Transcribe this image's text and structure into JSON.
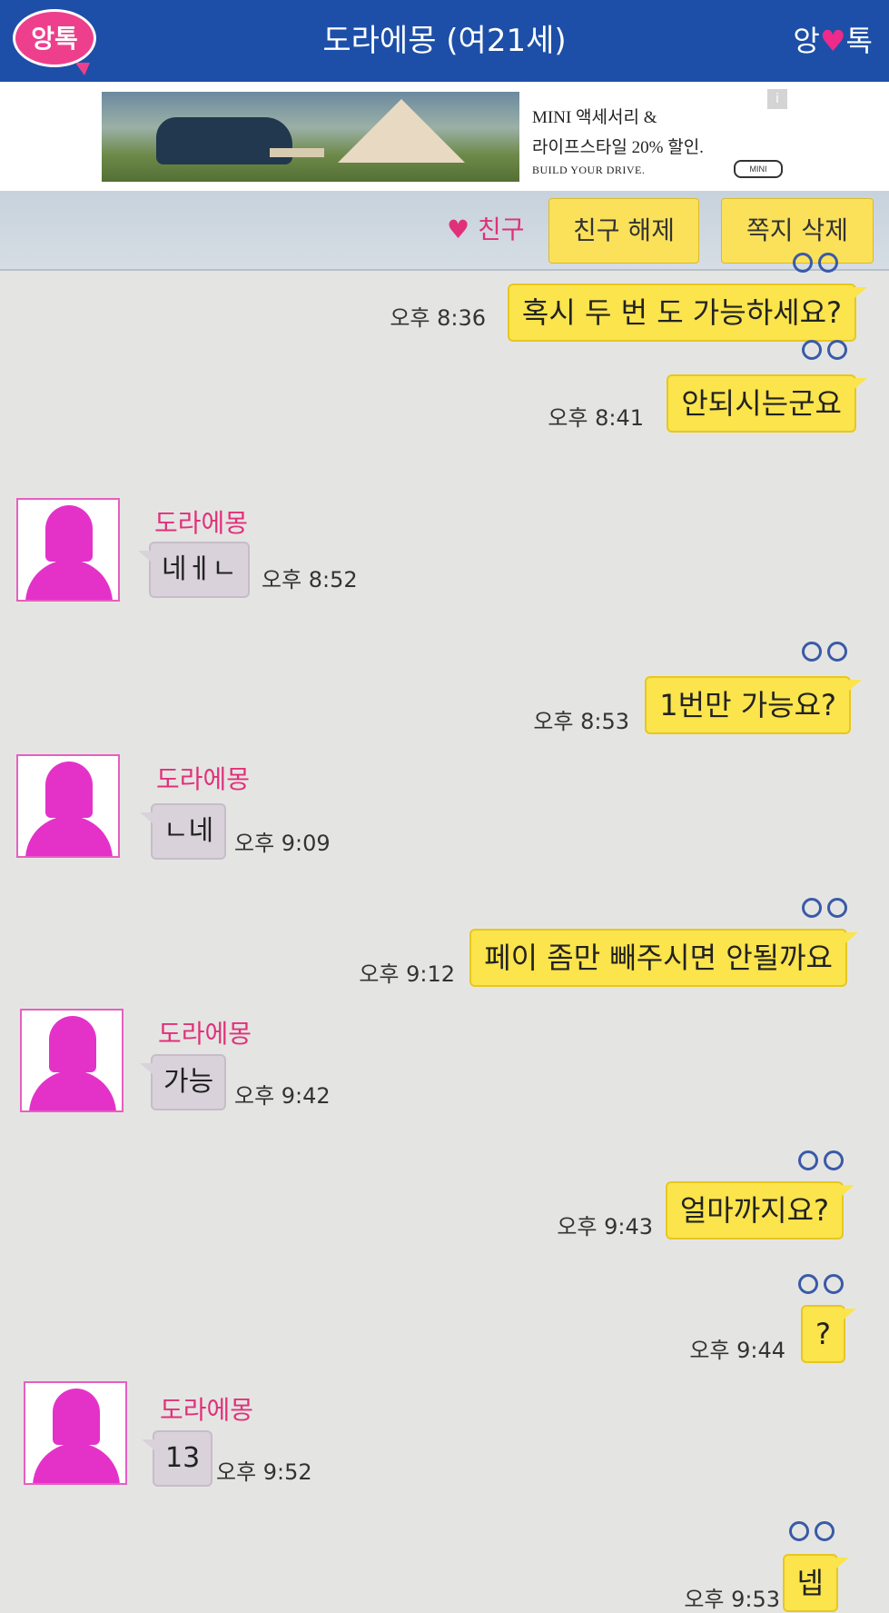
{
  "header": {
    "logo_text": "앙톡",
    "title": "도라에몽 (여21세)",
    "brand_left": "앙",
    "brand_heart": "♥",
    "brand_right": "톡"
  },
  "ad": {
    "line1": "MINI 액세서리 &",
    "line2": "라이프스타일 20% 할인.",
    "line3": "BUILD YOUR DRIVE.",
    "logo": "MINI",
    "info_icon": "i"
  },
  "toolbar": {
    "friend_label": "♥ 친구",
    "unfriend_button": "친구 해제",
    "delete_button": "쪽지 삭제"
  },
  "messages": [
    {
      "type": "out",
      "text": "혹시 두 번 도 가능하세요?",
      "time": "오후 8:36"
    },
    {
      "type": "out",
      "text": "안되시는군요",
      "time": "오후 8:41"
    },
    {
      "type": "in",
      "sender": "도라에몽",
      "text": "네ㅔㄴ",
      "time": "오후 8:52"
    },
    {
      "type": "out",
      "text": "1번만 가능요?",
      "time": "오후 8:53"
    },
    {
      "type": "in",
      "sender": "도라에몽",
      "text": "ㄴ네",
      "time": "오후 9:09"
    },
    {
      "type": "out",
      "text": "페이 좀만 빼주시면 안될까요",
      "time": "오후 9:12"
    },
    {
      "type": "in",
      "sender": "도라에몽",
      "text": "가능",
      "time": "오후 9:42"
    },
    {
      "type": "out",
      "text": "얼마까지요?",
      "time": "오후 9:43"
    },
    {
      "type": "out",
      "text": "?",
      "time": "오후 9:44"
    },
    {
      "type": "in",
      "sender": "도라에몽",
      "text": "13",
      "time": "오후 9:52"
    },
    {
      "type": "out",
      "text": "넵",
      "time": "오후 9:53"
    }
  ]
}
